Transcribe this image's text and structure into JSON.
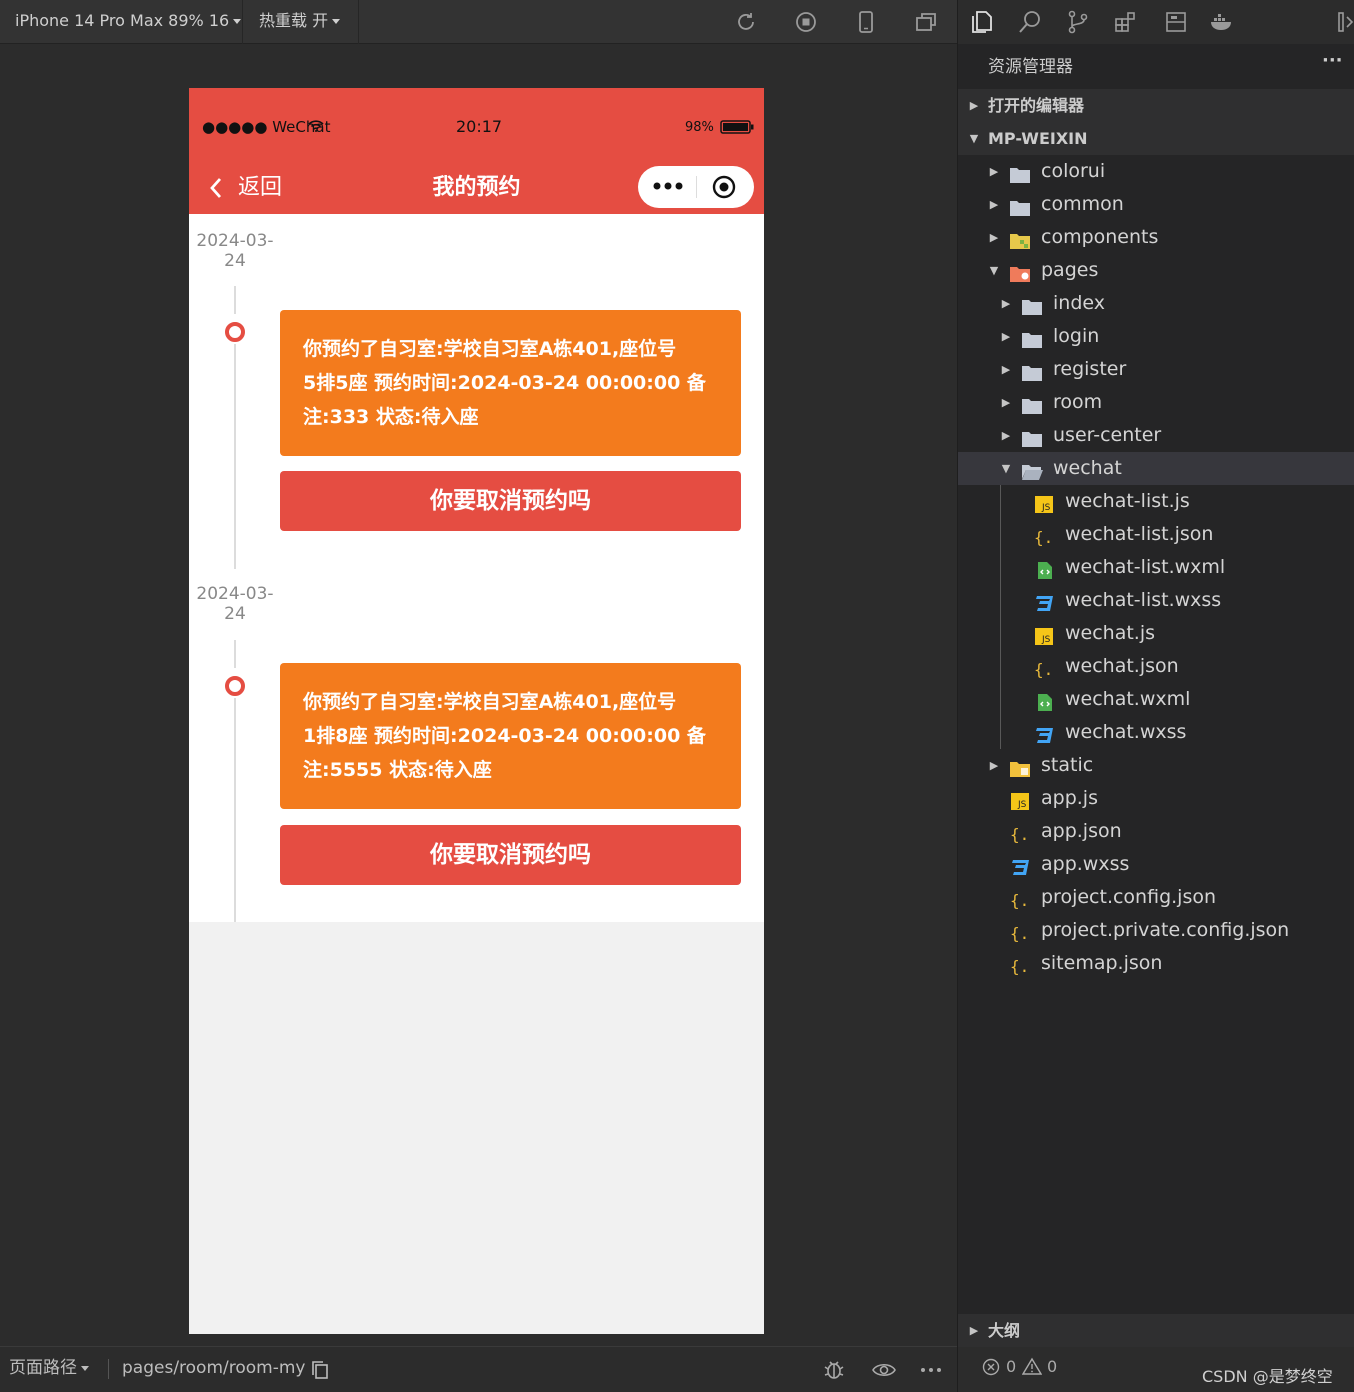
{
  "toolbar": {
    "device": "iPhone 14 Pro Max 89% 16",
    "hot_reload": "热重载 开"
  },
  "phone": {
    "status": {
      "carrier": "●●●●● WeChat",
      "time": "20:17",
      "battery": "98%"
    },
    "nav": {
      "back_label": "返回",
      "title": "我的预约"
    },
    "reservations": [
      {
        "date_line1": "2024-03-",
        "date_line2": "24",
        "line1": "你预约了自习室:学校自习室A栋401,座位号",
        "line2": "5排5座  预约时间:2024-03-24 00:00:00  备",
        "line3": "注:333  状态:待入座",
        "cancel_label": "你要取消预约吗"
      },
      {
        "date_line1": "2024-03-",
        "date_line2": "24",
        "line1": "你预约了自习室:学校自习室A栋401,座位号",
        "line2": "1排8座  预约时间:2024-03-24 00:00:00  备",
        "line3": "注:5555  状态:待入座",
        "cancel_label": "你要取消预约吗"
      }
    ]
  },
  "bottom_bar": {
    "path_label": "页面路径",
    "path": "pages/room/room-my"
  },
  "explorer": {
    "title": "资源管理器",
    "more": "···",
    "open_editors": "打开的编辑器",
    "project": "MP-WEIXIN",
    "tree": [
      {
        "label": "colorui",
        "icon": "folder-icon",
        "expanded": false
      },
      {
        "label": "common",
        "icon": "folder-icon",
        "expanded": false
      },
      {
        "label": "components",
        "icon": "components-folder-icon",
        "expanded": false
      },
      {
        "label": "pages",
        "icon": "pages-folder-icon",
        "expanded": true
      },
      {
        "label": "index",
        "icon": "folder-icon",
        "expanded": false
      },
      {
        "label": "login",
        "icon": "folder-icon",
        "expanded": false
      },
      {
        "label": "register",
        "icon": "folder-icon",
        "expanded": false
      },
      {
        "label": "room",
        "icon": "folder-icon",
        "expanded": false
      },
      {
        "label": "user-center",
        "icon": "folder-icon",
        "expanded": false
      },
      {
        "label": "wechat",
        "icon": "open-folder-icon",
        "expanded": true
      },
      {
        "label": "wechat-list.js",
        "icon": "js-file-icon"
      },
      {
        "label": "wechat-list.json",
        "icon": "json-file-icon"
      },
      {
        "label": "wechat-list.wxml",
        "icon": "wxml-file-icon"
      },
      {
        "label": "wechat-list.wxss",
        "icon": "wxss-file-icon"
      },
      {
        "label": "wechat.js",
        "icon": "js-file-icon"
      },
      {
        "label": "wechat.json",
        "icon": "json-file-icon"
      },
      {
        "label": "wechat.wxml",
        "icon": "wxml-file-icon"
      },
      {
        "label": "wechat.wxss",
        "icon": "wxss-file-icon"
      },
      {
        "label": "static",
        "icon": "static-folder-icon",
        "expanded": false
      },
      {
        "label": "app.js",
        "icon": "js-file-icon"
      },
      {
        "label": "app.json",
        "icon": "json-file-icon"
      },
      {
        "label": "app.wxss",
        "icon": "wxss-file-icon"
      },
      {
        "label": "project.config.json",
        "icon": "json-file-icon"
      },
      {
        "label": "project.private.config.json",
        "icon": "json-file-icon"
      },
      {
        "label": "sitemap.json",
        "icon": "json-file-icon"
      }
    ],
    "outline": "大纲",
    "errors": "0",
    "warnings": "0",
    "watermark": "CSDN @是梦终空"
  },
  "colors": {
    "brand_red": "#e54d42",
    "card_orange": "#f37b1d"
  }
}
